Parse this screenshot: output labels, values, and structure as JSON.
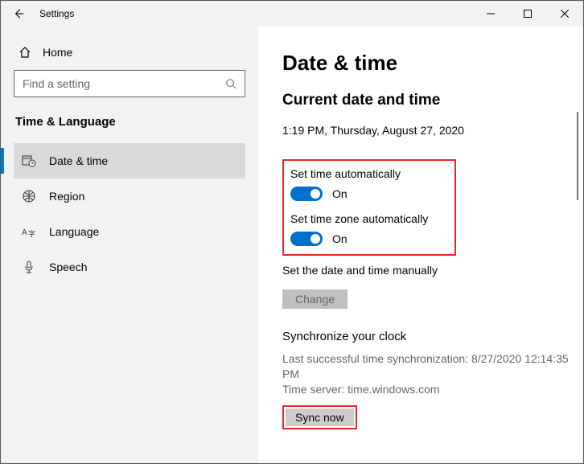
{
  "titlebar": {
    "back_label": "Back",
    "title": "Settings"
  },
  "sidebar": {
    "home": "Home",
    "search_placeholder": "Find a setting",
    "category": "Time & Language",
    "items": [
      {
        "label": "Date & time"
      },
      {
        "label": "Region"
      },
      {
        "label": "Language"
      },
      {
        "label": "Speech"
      }
    ]
  },
  "content": {
    "heading": "Date & time",
    "subheading": "Current date and time",
    "now": "1:19 PM, Thursday, August 27, 2020",
    "auto_time_label": "Set time automatically",
    "auto_time_state": "On",
    "auto_tz_label": "Set time zone automatically",
    "auto_tz_state": "On",
    "manual_label": "Set the date and time manually",
    "change_btn": "Change",
    "sync_title": "Synchronize your clock",
    "sync_line1": "Last successful time synchronization: 8/27/2020 12:14:35 PM",
    "sync_line2": "Time server: time.windows.com",
    "sync_btn": "Sync now"
  }
}
